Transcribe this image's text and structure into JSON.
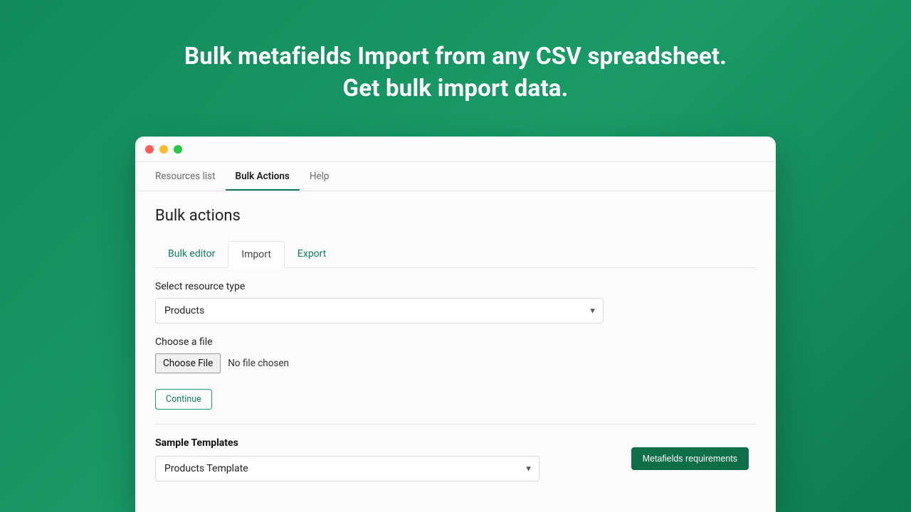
{
  "hero": {
    "line1": "Bulk metafields Import from any CSV spreadsheet.",
    "line2": "Get bulk import data."
  },
  "topTabs": {
    "resources": "Resources list",
    "bulk": "Bulk Actions",
    "help": "Help"
  },
  "pageTitle": "Bulk actions",
  "subTabs": {
    "editor": "Bulk editor",
    "import": "Import",
    "export": "Export"
  },
  "form": {
    "resourceLabel": "Select resource type",
    "resourceValue": "Products",
    "fileLabel": "Choose a file",
    "chooseFile": "Choose File",
    "fileStatus": "No file chosen",
    "continue": "Continue"
  },
  "sample": {
    "label": "Sample Templates",
    "value": "Products Template",
    "reqs": "Metafields requirements"
  }
}
